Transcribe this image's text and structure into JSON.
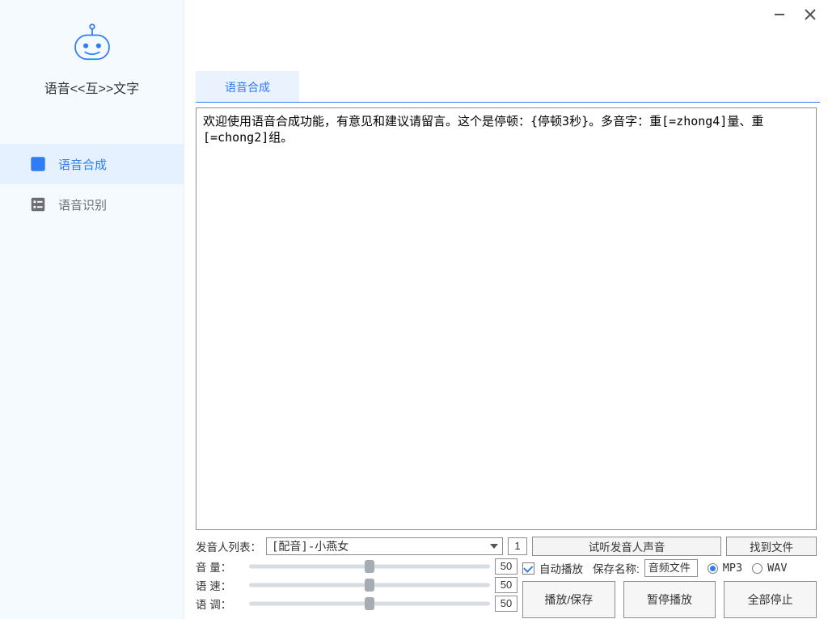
{
  "app_title": "语音<<互>>文字",
  "sidebar": {
    "items": [
      {
        "label": "语音合成"
      },
      {
        "label": "语音识别"
      }
    ]
  },
  "tab": {
    "label": "语音合成"
  },
  "editor": {
    "text": "欢迎使用语音合成功能，有意见和建议请留言。这个是停顿：{停顿3秒}。多音字：重[=zhong4]量、重[=chong2]组。"
  },
  "controls": {
    "voice_list_label": "发音人列表：",
    "voice_selected": "[配音]-小燕女",
    "loop_count": "1",
    "preview_btn": "试听发音人声音",
    "tofile_btn": "找到文件",
    "volume_label": "音 量：",
    "volume_value": "50",
    "speed_label": "语 速：",
    "speed_value": "50",
    "pitch_label": "语 调：",
    "pitch_value": "50",
    "autoplay_label": "自动播放",
    "savename_label": "保存名称:",
    "savename_value": "音频文件",
    "fmt_mp3": "MP3",
    "fmt_wav": "WAV",
    "play_save_btn": "播放/保存",
    "pause_btn": "暂停播放",
    "stop_all_btn": "全部停止"
  }
}
